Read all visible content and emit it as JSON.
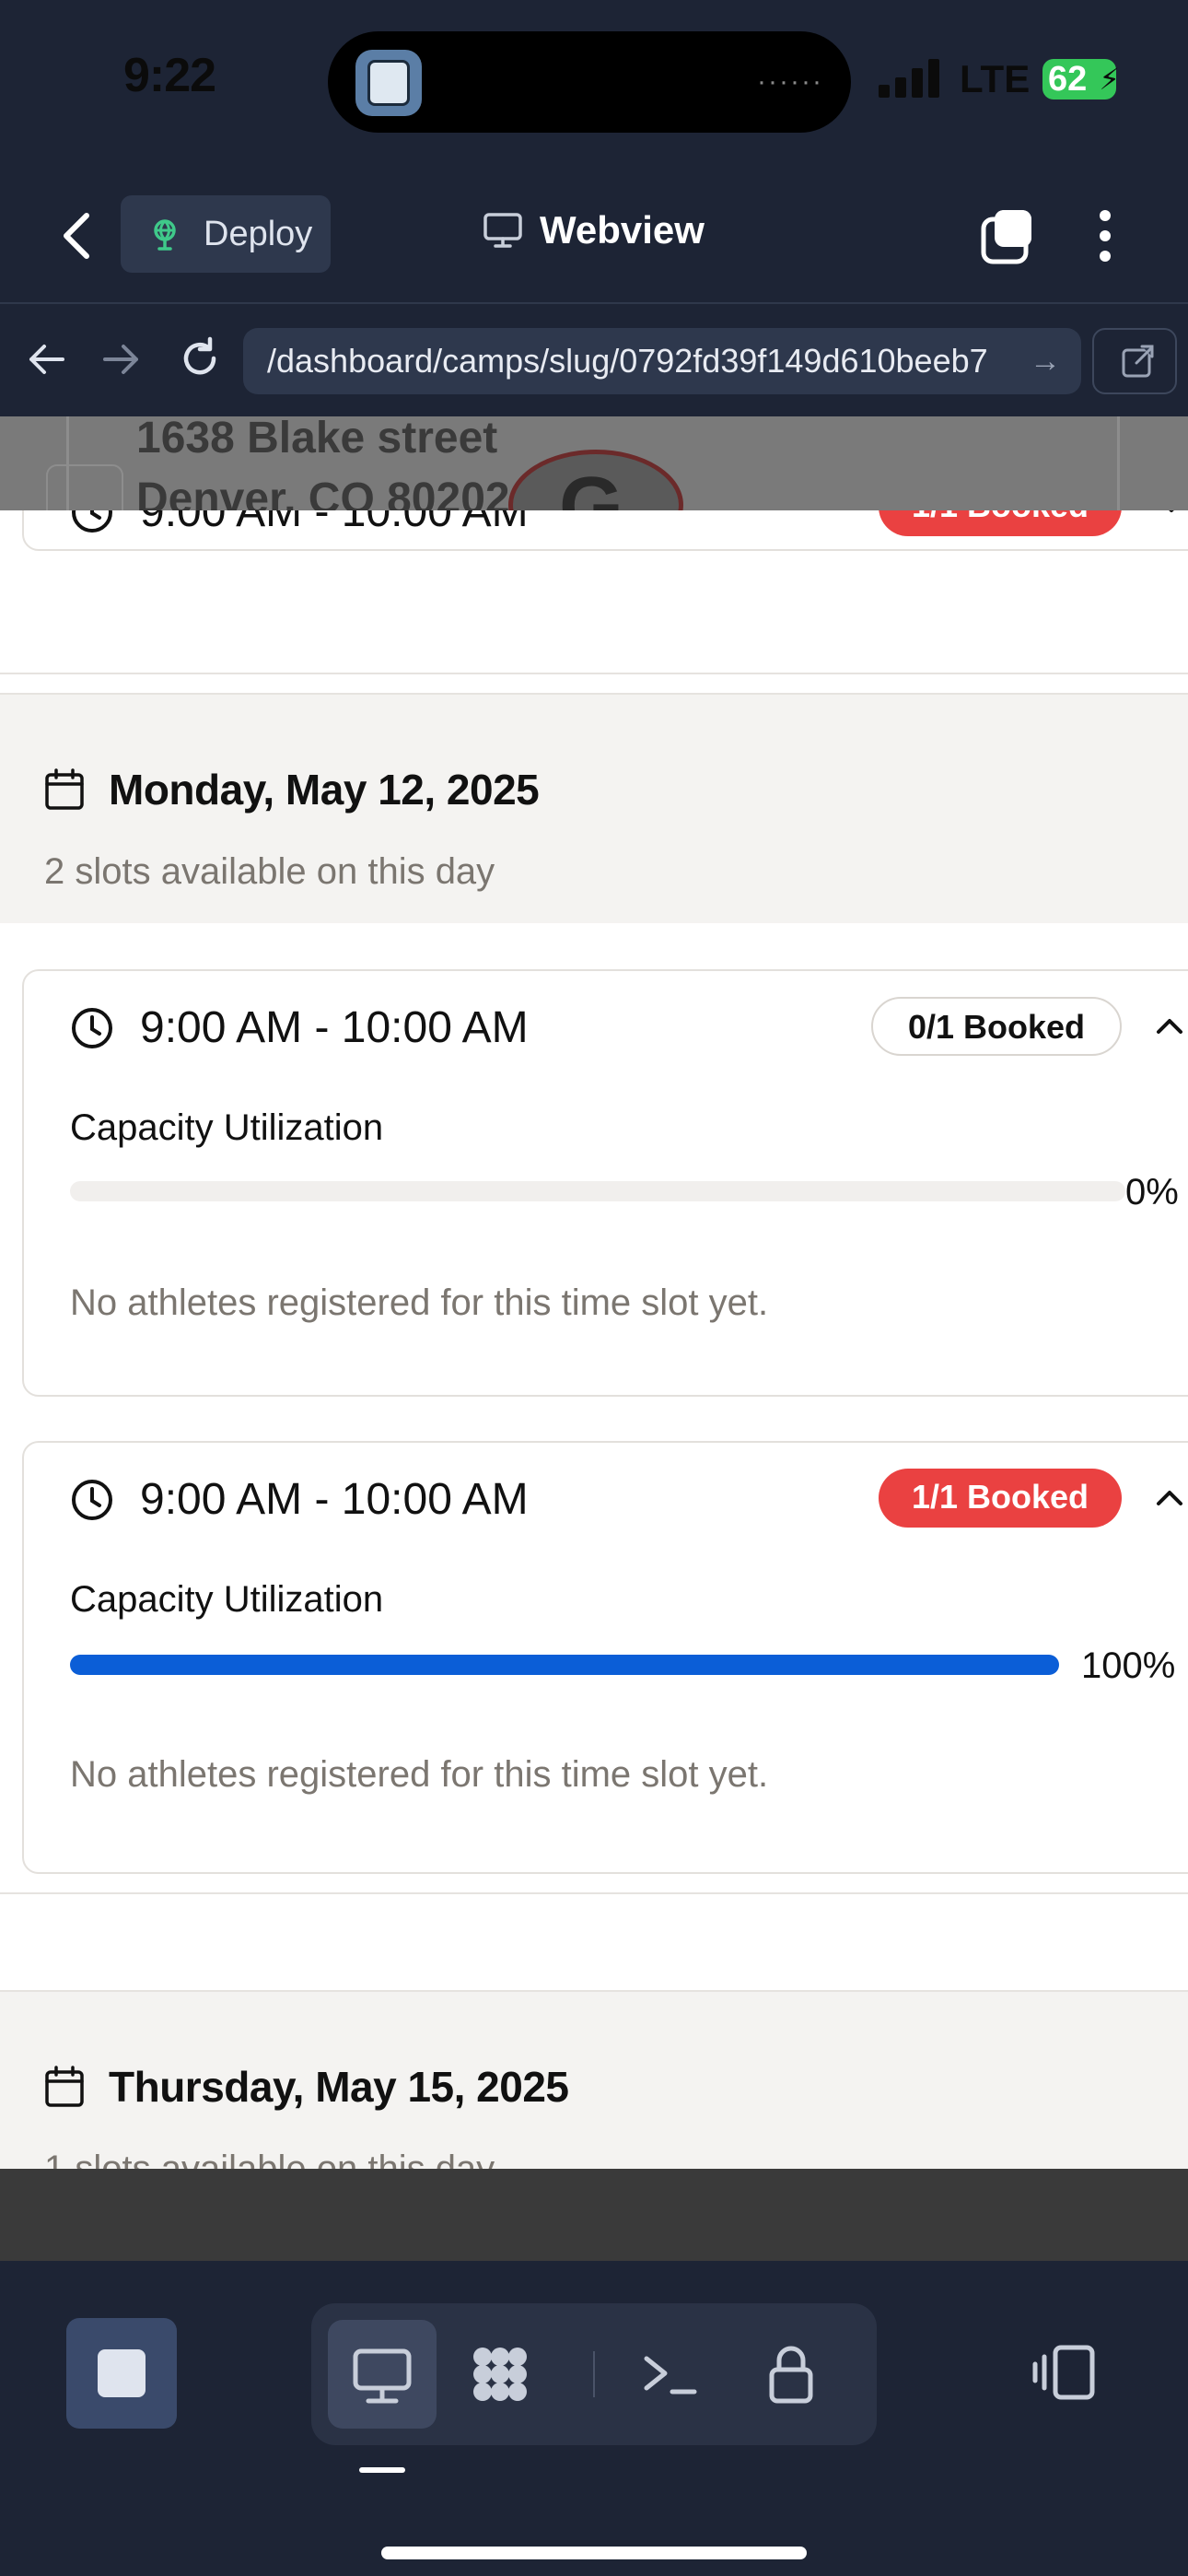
{
  "status_bar": {
    "time": "9:22",
    "network": "LTE",
    "battery": "62",
    "island_indicator": "······"
  },
  "header": {
    "deploy_label": "Deploy",
    "title": "Webview"
  },
  "url_bar": {
    "url": "/dashboard/camps/slug/0792fd39f149d610beeb7",
    "go_glyph": "→"
  },
  "background_page": {
    "address_line1": "1638 Blake street",
    "address_line2": "Denver, CO 80202"
  },
  "previous_slot": {
    "time": "9:00 AM - 10:00 AM",
    "badge": "1/1 Booked"
  },
  "days": [
    {
      "title": "Monday, May 12, 2025",
      "subtitle": "2 slots available on this day",
      "slots": [
        {
          "time": "9:00 AM - 10:00 AM",
          "badge": "0/1 Booked",
          "capacity_label": "Capacity Utilization",
          "utilization": 0,
          "utilization_label": "0%",
          "message": "No athletes registered for this time slot yet."
        },
        {
          "time": "9:00 AM - 10:00 AM",
          "badge": "1/1 Booked",
          "capacity_label": "Capacity Utilization",
          "utilization": 100,
          "utilization_label": "100%",
          "message": "No athletes registered for this time slot yet."
        }
      ]
    },
    {
      "title": "Thursday, May 15, 2025",
      "subtitle": "1 slots available on this day"
    }
  ],
  "colors": {
    "booked_full": "#ea4141",
    "progress": "#0b5ed7",
    "chrome": "#1d2435"
  },
  "dock": {
    "items": [
      "desktop-icon",
      "apps-icon",
      "terminal-icon",
      "lock-icon"
    ]
  }
}
